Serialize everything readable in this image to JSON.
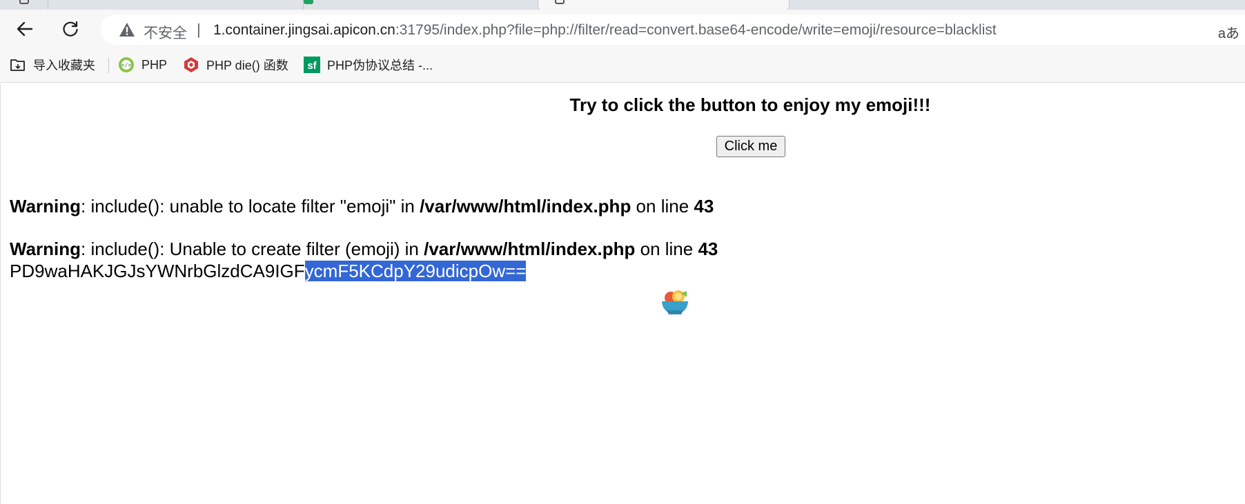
{
  "browser": {
    "address_bar": {
      "security_label": "不安全",
      "separator": "|",
      "url_host": "1.container.jingsai.apicon.cn",
      "url_rest": ":31795/index.php?file=php://filter/read=convert.base64-encode/write=emoji/resource=blacklist",
      "read_aloud_label": "aあ"
    },
    "bookmarks": [
      {
        "label": "导入收藏夹",
        "icon": "import-favorites-icon"
      },
      {
        "label": "PHP",
        "icon": "php-site-icon"
      },
      {
        "label": "PHP die() 函数",
        "icon": "runoob-icon"
      },
      {
        "label": "PHP伪协议总结 -...",
        "icon": "segmentfault-icon"
      }
    ]
  },
  "page": {
    "headline": "Try to click the button to enjoy my emoji!!!",
    "button_label": "Click me",
    "warnings": [
      {
        "label": "Warning",
        "message": ": include(): unable to locate filter \"emoji\" in ",
        "path": "/var/www/html/index.php",
        "on_line": " on line ",
        "line": "43"
      },
      {
        "label": "Warning",
        "message": ": include(): Unable to create filter (emoji) in ",
        "path": "/var/www/html/index.php",
        "on_line": " on line ",
        "line": "43"
      }
    ],
    "base64_output": {
      "plain": "PD9waHAKJGJsYWNrbGlzdCA9IGF",
      "selected": "ycmF5KCdpY29udicpOw=="
    },
    "emoji_icon": "fruit-bowl-emoji"
  },
  "colors": {
    "selection": "#3367d6",
    "chrome_bg": "#f7f7f7",
    "text": "#000000"
  }
}
